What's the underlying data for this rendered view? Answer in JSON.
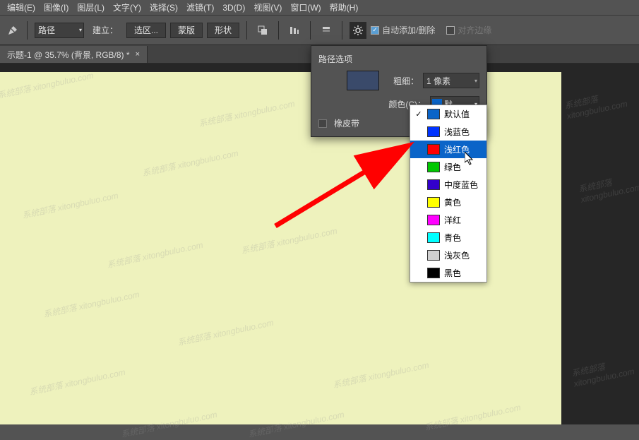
{
  "menubar": {
    "items": [
      "编辑(E)",
      "图像(I)",
      "图层(L)",
      "文字(Y)",
      "选择(S)",
      "滤镜(T)",
      "3D(D)",
      "视图(V)",
      "窗口(W)",
      "帮助(H)"
    ]
  },
  "toolbar": {
    "mode_label": "路径",
    "build_label": "建立：",
    "btn_selection": "选区...",
    "btn_mask": "蒙版",
    "btn_shape": "形状",
    "auto_add_delete": "自动添加/删除",
    "align_edges": "对齐边缘"
  },
  "tab": {
    "title": "示题-1 @ 35.7% (背景, RGB/8) *"
  },
  "panel": {
    "title": "路径选项",
    "thickness_label": "粗细：",
    "thickness_value": "1 像素",
    "color_label": "颜色(C)：",
    "color_value": "默...",
    "rubber_band": "橡皮带"
  },
  "color_menu": {
    "items": [
      {
        "label": "默认值",
        "color": "#0a64c8",
        "checked": true
      },
      {
        "label": "浅蓝色",
        "color": "#0033ff"
      },
      {
        "label": "浅红色",
        "color": "#ff0000",
        "selected": true
      },
      {
        "label": "绿色",
        "color": "#00c800"
      },
      {
        "label": "中度蓝色",
        "color": "#3300cc"
      },
      {
        "label": "黄色",
        "color": "#ffff00"
      },
      {
        "label": "洋红",
        "color": "#ff00ff"
      },
      {
        "label": "青色",
        "color": "#00ffff"
      },
      {
        "label": "浅灰色",
        "color": "#d0d0d0"
      },
      {
        "label": "黑色",
        "color": "#000000"
      }
    ]
  },
  "watermark_text": "系统部落 xitongbuluo.com"
}
